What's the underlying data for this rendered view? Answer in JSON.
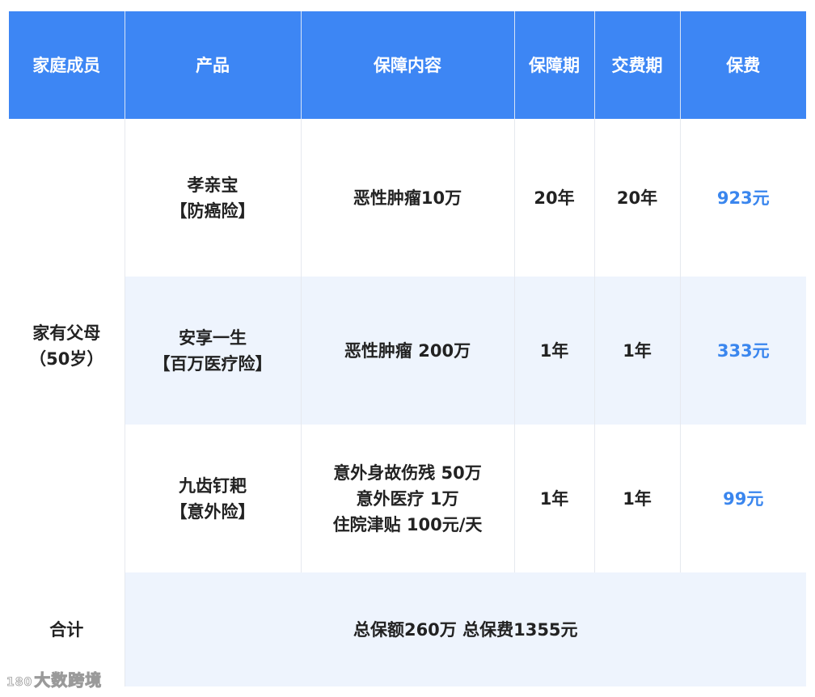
{
  "table": {
    "headers": [
      "家庭成员",
      "产品",
      "保障内容",
      "保障期",
      "交费期",
      "保费"
    ],
    "member_lines": [
      "家有父母",
      "（50岁）"
    ],
    "rows": [
      {
        "product_lines": [
          "孝亲宝",
          "【防癌险】"
        ],
        "coverage_lines": [
          "恶性肿瘤10万"
        ],
        "coverage_period": "20年",
        "payment_period": "20年",
        "premium": "923元"
      },
      {
        "product_lines": [
          "安享一生",
          "【百万医疗险】"
        ],
        "coverage_lines": [
          "恶性肿瘤 200万"
        ],
        "coverage_period": "1年",
        "payment_period": "1年",
        "premium": "333元"
      },
      {
        "product_lines": [
          "九齿钉耙",
          "【意外险】"
        ],
        "coverage_lines": [
          "意外身故伤残 50万",
          "意外医疗 1万",
          "住院津贴 100元/天"
        ],
        "coverage_period": "1年",
        "payment_period": "1年",
        "premium": "99元"
      }
    ],
    "total": {
      "label": "合计",
      "value": "总保额260万 总保费1355元"
    }
  },
  "watermark": {
    "logo": "180",
    "text": "大数跨境"
  },
  "colors": {
    "header_bg": "#3d86f4",
    "header_text": "#ffffff",
    "stripe_bg": "#eef4fd",
    "premium_text": "#3a86ee"
  }
}
